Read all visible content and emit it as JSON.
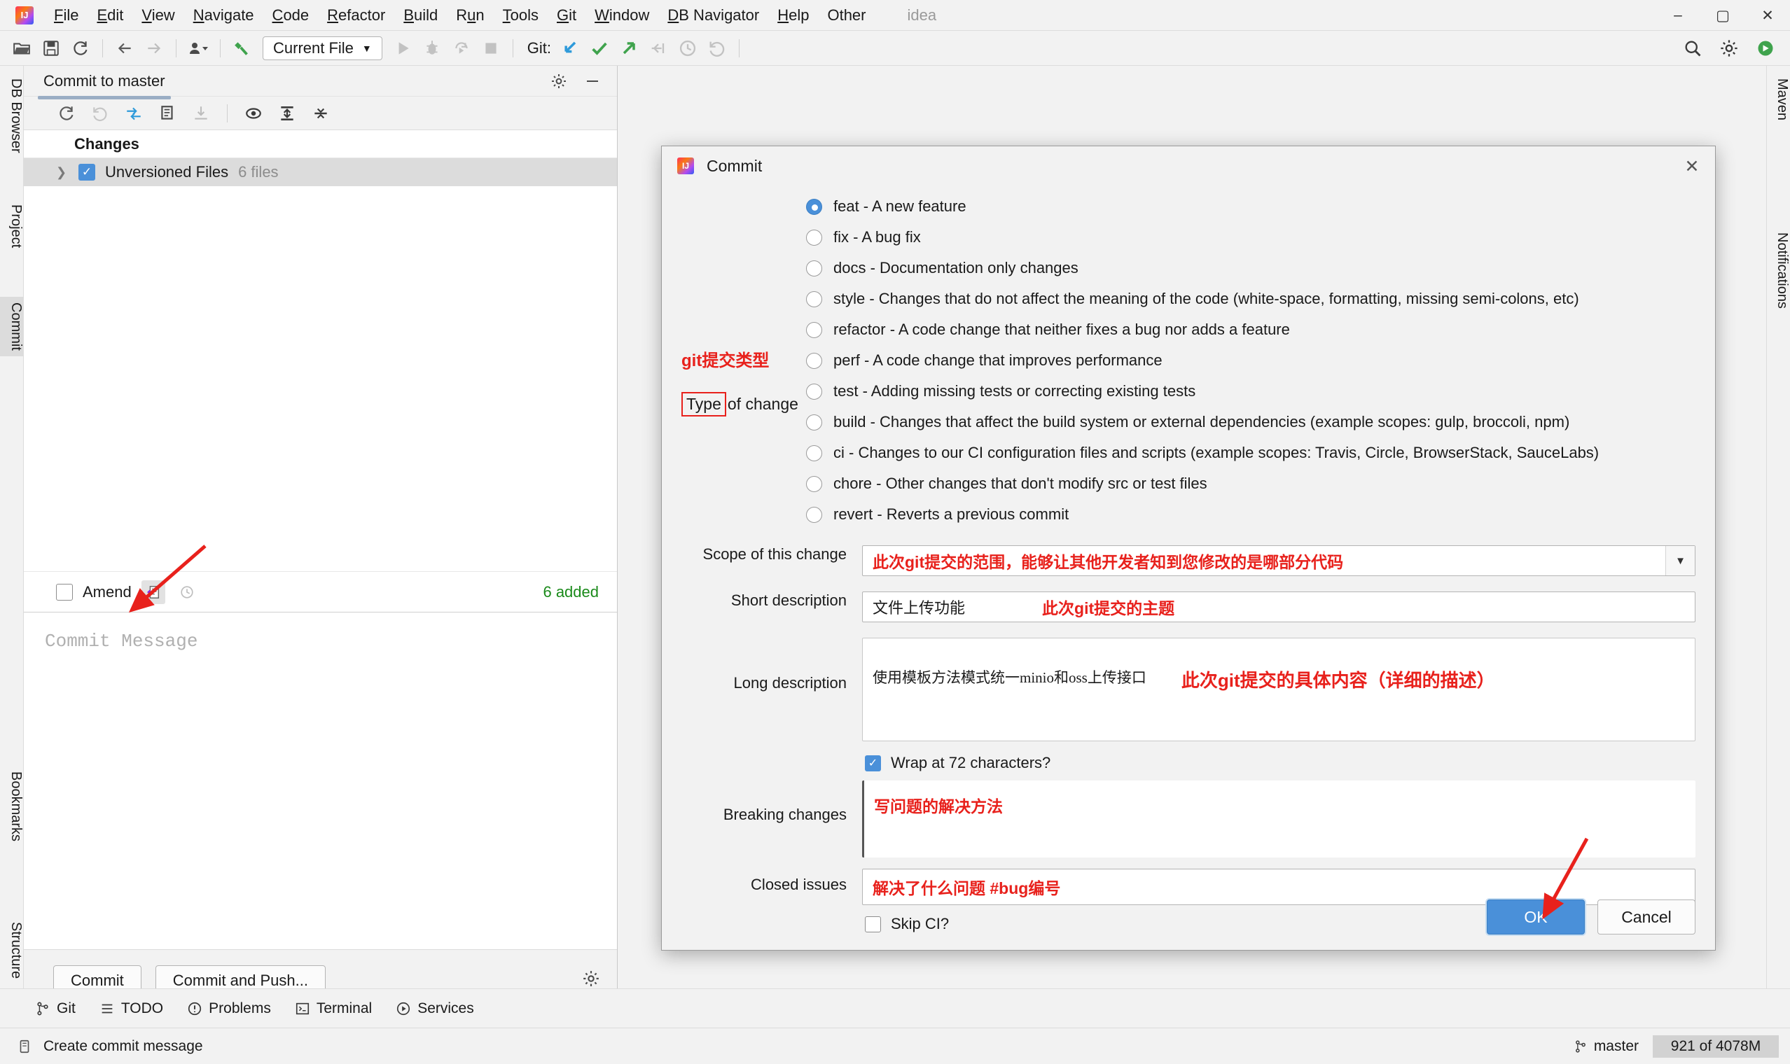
{
  "window": {
    "app_label": "idea",
    "minimize": "–",
    "maximize": "▢",
    "close": "✕"
  },
  "menu": [
    {
      "label": "File",
      "mn": "F"
    },
    {
      "label": "Edit",
      "mn": "E"
    },
    {
      "label": "View",
      "mn": "V"
    },
    {
      "label": "Navigate",
      "mn": "N"
    },
    {
      "label": "Code",
      "mn": "C"
    },
    {
      "label": "Refactor",
      "mn": "R"
    },
    {
      "label": "Build",
      "mn": "B"
    },
    {
      "label": "Run",
      "mn": "u"
    },
    {
      "label": "Tools",
      "mn": "T"
    },
    {
      "label": "Git",
      "mn": "G"
    },
    {
      "label": "Window",
      "mn": "W"
    },
    {
      "label": "DB Navigator",
      "mn": "D"
    },
    {
      "label": "Help",
      "mn": "H"
    },
    {
      "label": "Other",
      "mn": ""
    }
  ],
  "toolbar": {
    "run_config": "Current File",
    "git_label": "Git:"
  },
  "left_strip": {
    "db_browser": "DB Browser",
    "project": "Project",
    "commit": "Commit",
    "bookmarks": "Bookmarks",
    "structure": "Structure"
  },
  "right_strip": {
    "maven": "Maven",
    "notifications": "Notifications"
  },
  "commit_panel": {
    "tab_title": "Commit to master",
    "changes_header": "Changes",
    "unversioned_label": "Unversioned Files",
    "unversioned_count": "6 files",
    "amend_label": "Amend",
    "added_label": "6 added",
    "message_placeholder": "Commit Message",
    "commit_button": "Commit",
    "commit_push_button": "Commit and Push..."
  },
  "dialog": {
    "title": "Commit",
    "annotation_type_cn": "git提交类型",
    "type_boxed_word": "Type",
    "type_rest_word": " of change",
    "types": [
      {
        "id": "feat",
        "label": "feat - A new feature",
        "checked": true
      },
      {
        "id": "fix",
        "label": "fix - A bug fix",
        "checked": false
      },
      {
        "id": "docs",
        "label": "docs - Documentation only changes",
        "checked": false
      },
      {
        "id": "style",
        "label": "style - Changes that do not affect the meaning of the code (white-space, formatting, missing semi-colons, etc)",
        "checked": false
      },
      {
        "id": "refactor",
        "label": "refactor - A code change that neither fixes a bug nor adds a feature",
        "checked": false
      },
      {
        "id": "perf",
        "label": "perf - A code change that improves performance",
        "checked": false
      },
      {
        "id": "test",
        "label": "test - Adding missing tests or correcting existing tests",
        "checked": false
      },
      {
        "id": "build",
        "label": "build - Changes that affect the build system or external dependencies (example scopes: gulp, broccoli, npm)",
        "checked": false
      },
      {
        "id": "ci",
        "label": "ci - Changes to our CI configuration files and scripts (example scopes: Travis, Circle, BrowserStack, SauceLabs)",
        "checked": false
      },
      {
        "id": "chore",
        "label": "chore - Other changes that don't modify src or test files",
        "checked": false
      },
      {
        "id": "revert",
        "label": "revert - Reverts a previous commit",
        "checked": false
      }
    ],
    "scope_label": "Scope of this change",
    "scope_value": "此次git提交的范围，能够让其他开发者知到您修改的是哪部分代码",
    "short_label": "Short description",
    "short_value": "文件上传功能",
    "short_annotation": "此次git提交的主题",
    "long_label": "Long description",
    "long_value": "使用模板方法模式统一minio和oss上传接口",
    "long_annotation": "此次git提交的具体内容（详细的描述）",
    "wrap_label": "Wrap at 72 characters?",
    "wrap_checked": true,
    "breaking_label": "Breaking changes",
    "breaking_value": "写问题的解决方法",
    "closed_label": "Closed issues",
    "closed_value": "解决了什么问题  #bug编号",
    "skip_ci_label": "Skip CI?",
    "skip_ci_checked": false,
    "ok_button": "OK",
    "cancel_button": "Cancel"
  },
  "bottom_bar": [
    {
      "label": "Git",
      "icon": "git-branch-icon"
    },
    {
      "label": "TODO",
      "icon": "todo-icon"
    },
    {
      "label": "Problems",
      "icon": "problems-icon"
    },
    {
      "label": "Terminal",
      "icon": "terminal-icon"
    },
    {
      "label": "Services",
      "icon": "services-icon"
    }
  ],
  "status_bar": {
    "message": "Create commit message",
    "branch": "master",
    "memory": "921 of 4078M"
  },
  "colors": {
    "accent_blue": "#4a90d9",
    "annotation_red": "#e8211c",
    "added_green": "#1a8a1a"
  }
}
